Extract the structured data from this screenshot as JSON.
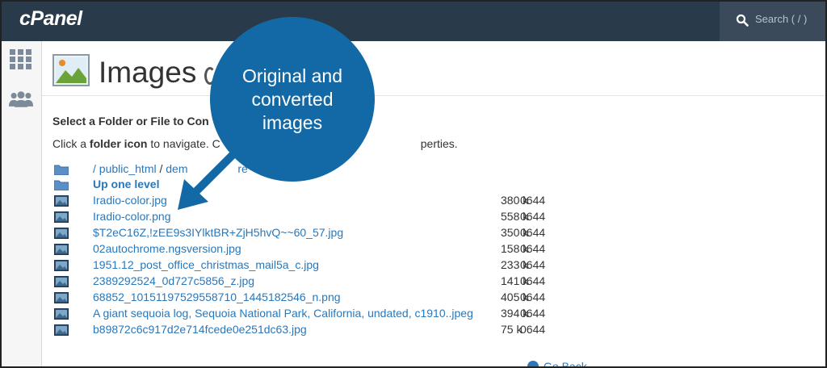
{
  "brand": {
    "logo": "cPanel",
    "accent": "#1369a6",
    "link_color": "#2a77b9",
    "topbar_color": "#293a4a"
  },
  "search": {
    "placeholder": "Search ( / )",
    "icon": "search-icon"
  },
  "rail": {
    "items": [
      {
        "icon": "grid-icon"
      },
      {
        "icon": "users-icon"
      }
    ]
  },
  "page": {
    "title": "Images",
    "icon": "image-icon"
  },
  "browser": {
    "heading": "Select a Folder or File to Con",
    "instructions_pre": "Click a ",
    "instructions_bold": "folder icon",
    "instructions_mid": " to navigate. C",
    "instructions_tail": "perties.",
    "path": {
      "root": "/ public_html",
      "sep": "/",
      "part": "dem",
      "tail": "re"
    },
    "up_level": "Up one level",
    "files": [
      {
        "name": "Iradio-color.jpg",
        "size": "380 k",
        "perm": "0644"
      },
      {
        "name": "Iradio-color.png",
        "size": "558 k",
        "perm": "0644"
      },
      {
        "name": "$T2eC16Z,!zEE9s3IYlktBR+ZjH5hvQ~~60_57.jpg",
        "size": "350 k",
        "perm": "0644"
      },
      {
        "name": "02autochrome.ngsversion.jpg",
        "size": "158 k",
        "perm": "0644"
      },
      {
        "name": "1951.12_post_office_christmas_mail5a_c.jpg",
        "size": "233 k",
        "perm": "0644"
      },
      {
        "name": "2389292524_0d727c5856_z.jpg",
        "size": "141 k",
        "perm": "0644"
      },
      {
        "name": "68852_10151197529558710_1445182546_n.png",
        "size": "405 k",
        "perm": "0644"
      },
      {
        "name": "A giant sequoia log, Sequoia National Park, California, undated, c1910..jpeg",
        "size": "394 k",
        "perm": "0644"
      },
      {
        "name": "b89872c6c917d2e714fcede0e251dc63.jpg",
        "size": "75 k",
        "perm": "0644"
      }
    ],
    "go_back": "Go Back"
  },
  "callout": {
    "text": "Original and converted images"
  }
}
